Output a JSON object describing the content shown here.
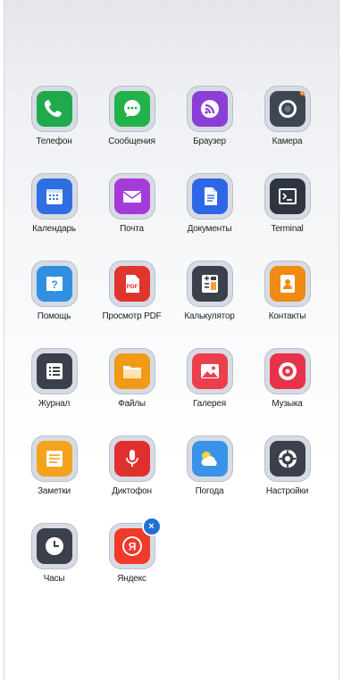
{
  "apps": [
    {
      "label": "Телефон",
      "icon": "phone-icon",
      "color": "#1faa4b"
    },
    {
      "label": "Сообщения",
      "icon": "messages-icon",
      "color": "#22b24a"
    },
    {
      "label": "Браузер",
      "icon": "browser-icon",
      "color": "#8b3fd6"
    },
    {
      "label": "Камера",
      "icon": "camera-icon",
      "color": "#3e4652"
    },
    {
      "label": "Календарь",
      "icon": "calendar-icon",
      "color": "#2f6ee0"
    },
    {
      "label": "Почта",
      "icon": "mail-icon",
      "color": "#a43bd8"
    },
    {
      "label": "Документы",
      "icon": "documents-icon",
      "color": "#2e67e6"
    },
    {
      "label": "Terminal",
      "icon": "terminal-icon",
      "color": "#2f3540"
    },
    {
      "label": "Помощь",
      "icon": "help-icon",
      "color": "#2f8fe0"
    },
    {
      "label": "Просмотр PDF",
      "icon": "pdf-icon",
      "color": "#e0352c"
    },
    {
      "label": "Калькулятор",
      "icon": "calculator-icon",
      "color": "#3a414c"
    },
    {
      "label": "Контакты",
      "icon": "contacts-icon",
      "color": "#f08a12"
    },
    {
      "label": "Журнал",
      "icon": "journal-icon",
      "color": "#3a414c"
    },
    {
      "label": "Файлы",
      "icon": "files-icon",
      "color": "#f09a18"
    },
    {
      "label": "Галерея",
      "icon": "gallery-icon",
      "color": "#ec3f4e"
    },
    {
      "label": "Музыка",
      "icon": "music-icon",
      "color": "#e8324a"
    },
    {
      "label": "Заметки",
      "icon": "notes-icon",
      "color": "#f5a21c"
    },
    {
      "label": "Диктофон",
      "icon": "recorder-icon",
      "color": "#e0302e"
    },
    {
      "label": "Погода",
      "icon": "weather-icon",
      "color": "#3a93e8"
    },
    {
      "label": "Настройки",
      "icon": "settings-icon",
      "color": "#3a414c"
    },
    {
      "label": "Часы",
      "icon": "clock-icon",
      "color": "#3a414c"
    },
    {
      "label": "Яндекс",
      "icon": "yandex-icon",
      "color": "#f03a2a",
      "badge": "×"
    }
  ]
}
